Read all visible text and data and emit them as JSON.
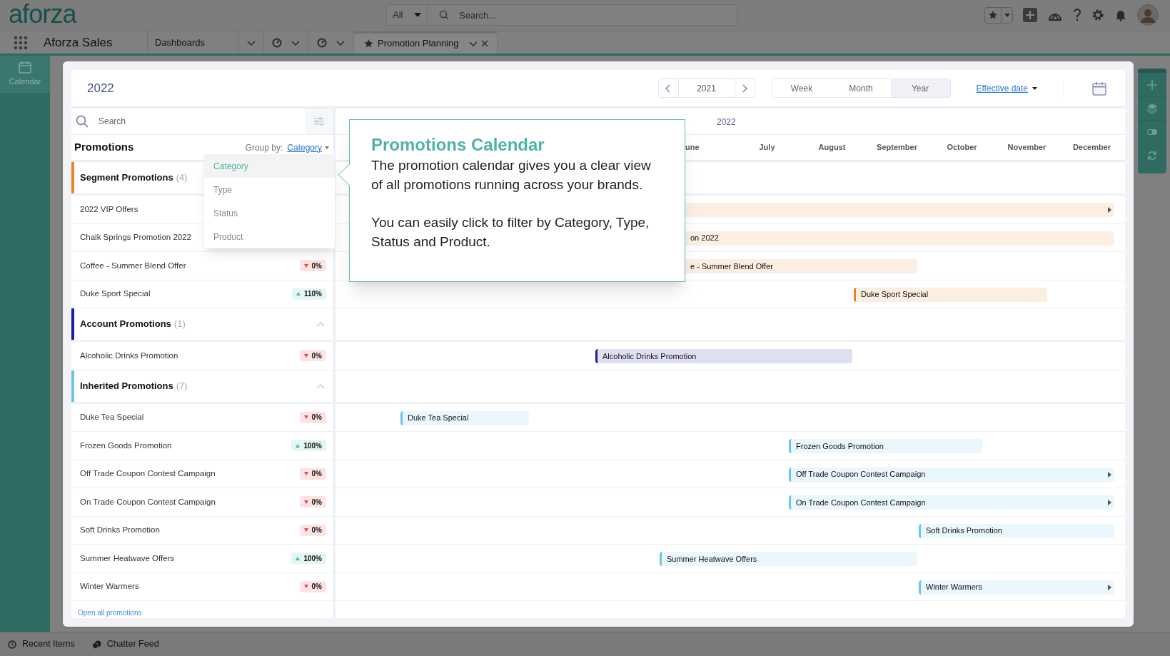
{
  "top_bar": {
    "logo": "aforza",
    "search_scope": "All",
    "search_placeholder": "Search..."
  },
  "nav": {
    "app_name": "Aforza Sales",
    "tabs": [
      {
        "kind": "text",
        "label": "Dashboards",
        "selected": false
      },
      {
        "kind": "gauge",
        "selected": false
      },
      {
        "kind": "gauge",
        "selected": false
      },
      {
        "kind": "pinned",
        "label": "Promotion Planning",
        "selected": true
      }
    ]
  },
  "sidebar": {
    "items": [
      {
        "label": "Calendar",
        "selected": true
      }
    ]
  },
  "calendar": {
    "title": "2022",
    "year_picker": "2021",
    "views": [
      {
        "label": "Week",
        "selected": false
      },
      {
        "label": "Month",
        "selected": false
      },
      {
        "label": "Year",
        "selected": true
      }
    ],
    "date_field": "Effective date",
    "search_placeholder": "Search",
    "list_title": "Promotions",
    "group_by_label": "Group by:",
    "group_by_value": "Category",
    "timeline_year": "2022",
    "months": [
      "une",
      "July",
      "August",
      "September",
      "October",
      "November",
      "December"
    ],
    "groups": [
      {
        "name": "Segment Promotions",
        "count": "(4)",
        "color": "#e8842c",
        "items": [
          {
            "name": "2022 VIP Offers",
            "bar_clipped": true,
            "continues": true
          },
          {
            "name": "Chalk Springs Promotion 2022",
            "bar_label": "on 2022",
            "bar_clipped": true,
            "continues": false
          },
          {
            "name": "Coffee - Summer Blend Offer",
            "change": "0%",
            "kind": "decrease",
            "bar_label": "e - Summer Blend Offer",
            "bar_clipped": true,
            "continues": false
          },
          {
            "name": "Duke Sport Special",
            "change": "110%",
            "kind": "increase",
            "bar_label": "Duke Sport Special",
            "bar_clipped": false,
            "continues": false
          }
        ]
      },
      {
        "name": "Account Promotions",
        "count": "(1)",
        "color": "#1c1ca6",
        "expanded": true,
        "items": [
          {
            "name": "Alcoholic Drinks Promotion",
            "change": "0%",
            "kind": "decrease",
            "bar_label": "Alcoholic Drinks Promotion",
            "bar_clipped": false,
            "continues": false
          }
        ]
      },
      {
        "name": "Inherited Promotions",
        "count": "(7)",
        "color": "#6cc3f2",
        "expanded": true,
        "items": [
          {
            "name": "Duke Tea Special",
            "change": "0%",
            "kind": "decrease",
            "bar_label": "Duke Tea Special",
            "bar_clipped": false,
            "continues": false
          },
          {
            "name": "Frozen Goods Promotion",
            "change": "100%",
            "kind": "increase",
            "bar_label": "Frozen Goods Promotion",
            "bar_clipped": false,
            "continues": false
          },
          {
            "name": "Off Trade Coupon Contest Campaign",
            "change": "0%",
            "kind": "decrease",
            "bar_label": "Off Trade Coupon Contest Campaign",
            "bar_clipped": false,
            "continues": true
          },
          {
            "name": "On Trade Coupon Contest Campaign",
            "change": "0%",
            "kind": "decrease",
            "bar_label": "On Trade Coupon Contest Campaign",
            "bar_clipped": false,
            "continues": true
          },
          {
            "name": "Soft Drinks Promotion",
            "change": "0%",
            "kind": "decrease",
            "bar_label": "Soft Drinks Promotion",
            "bar_clipped": false,
            "continues": false
          },
          {
            "name": "Summer Heatwave Offers",
            "change": "100%",
            "kind": "increase",
            "bar_label": "Summer Heatwave Offers",
            "bar_clipped": false,
            "continues": false
          },
          {
            "name": "Winter Warmers",
            "change": "0%",
            "kind": "decrease",
            "bar_label": "Winter Warmers",
            "bar_clipped": false,
            "continues": true
          }
        ]
      }
    ],
    "footer_link": "Open all promotions",
    "group_menu": {
      "options": [
        {
          "label": "Category",
          "selected": true
        },
        {
          "label": "Type",
          "selected": false
        },
        {
          "label": "Status",
          "selected": false
        },
        {
          "label": "Product",
          "selected": false
        }
      ]
    },
    "callout": {
      "title": "Promotions Calendar",
      "paragraphs": [
        "The promotion calendar gives you a clear view of all promotions running across your brands.",
        "You can easily click to filter by Category, Type, Status and Product."
      ]
    }
  },
  "utility_bar": {
    "items": [
      {
        "kind": "history",
        "label": "Recent Items"
      },
      {
        "kind": "chat",
        "label": "Chatter Feed"
      }
    ]
  }
}
